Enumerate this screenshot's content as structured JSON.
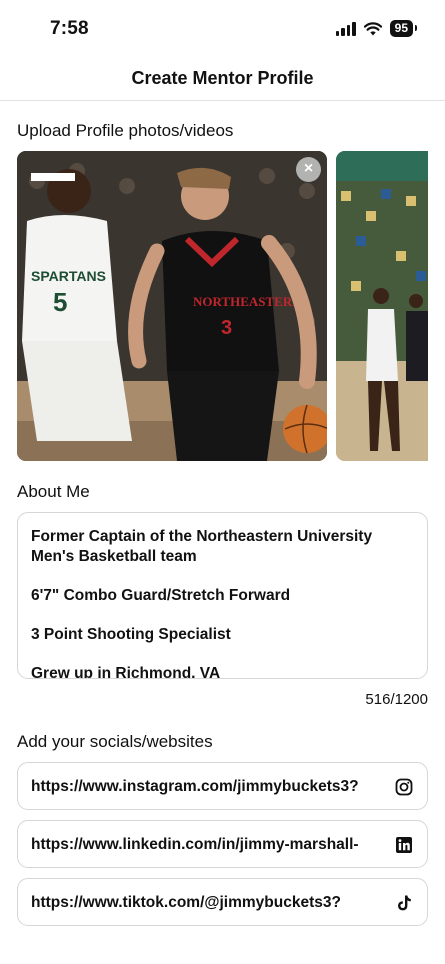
{
  "status": {
    "time": "7:58",
    "battery": "95"
  },
  "header": {
    "title": "Create Mentor Profile"
  },
  "photos": {
    "label": "Upload Profile photos/videos",
    "remove_symbol": "×"
  },
  "about": {
    "label": "About Me",
    "lines": [
      "Former Captain of the Northeastern University Men's Basketball team",
      "6'7\" Combo Guard/Stretch Forward",
      "3 Point Shooting Specialist",
      "Grew up in Richmond, VA"
    ],
    "counter": "516/1200"
  },
  "socials": {
    "label": "Add your socials/websites",
    "items": [
      {
        "value": "https://www.instagram.com/jimmybuckets3?",
        "icon": "instagram-icon"
      },
      {
        "value": "https://www.linkedin.com/in/jimmy-marshall-",
        "icon": "linkedin-icon"
      },
      {
        "value": "https://www.tiktok.com/@jimmybuckets3?",
        "icon": "tiktok-icon"
      }
    ]
  }
}
